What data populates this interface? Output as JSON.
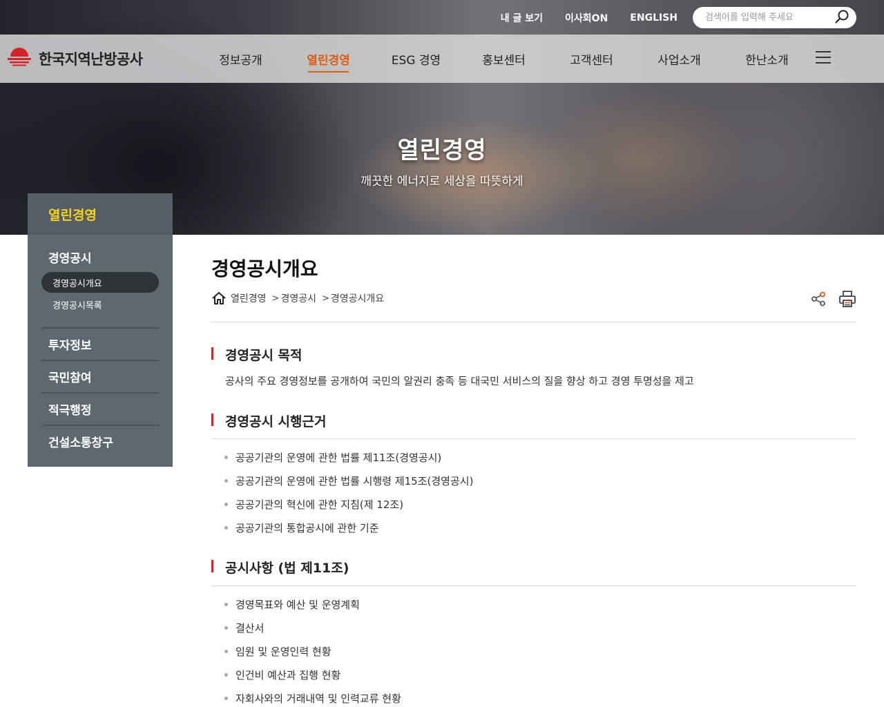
{
  "utility": {
    "my_posts": "내 글 보기",
    "board_on": "이사회ON",
    "english": "ENGLISH",
    "search_placeholder": "검색어를 입력해 주세요"
  },
  "logo": {
    "text": "한국지역난방공사",
    "brand_color": "#d3222a"
  },
  "gnb": {
    "items": [
      "정보공개",
      "열린경영",
      "ESG 경영",
      "홍보센터",
      "고객센터",
      "사업소개",
      "한난소개"
    ],
    "active_index": 1,
    "active_color": "#e05a12"
  },
  "hero": {
    "title": "열린경영",
    "subtitle": "깨끗한 에너지로 세상을 따뜻하게"
  },
  "lnb": {
    "title": "열린경영",
    "title_color": "#f7d31b",
    "group_title": "경영공시",
    "sub_items": [
      "경영공시개요",
      "경영공시목록"
    ],
    "active_sub_index": 0,
    "items": [
      "투자정보",
      "국민참여",
      "적극행정",
      "건설소통창구"
    ]
  },
  "page": {
    "title": "경영공시개요",
    "breadcrumb": [
      "열린경영",
      "경영공시",
      "경영공시개요"
    ]
  },
  "sections": [
    {
      "title": "경영공시 목적",
      "text": "공사의 주요 경영정보를 공개하여 국민의 알권리 충족 등 대국민 서비스의 질을 향상 하고 경영 투명성을 제고"
    },
    {
      "title": "경영공시 시행근거",
      "items": [
        "공공기관의 운영에 관한 법률 제11조(경영공시)",
        "공공기관의 운영에 관한 법률 시행령 제15조(경영공시)",
        "공공기관의 혁신에 관한 지침(제 12조)",
        "공공기관의 통합공시에 관한 기준"
      ]
    },
    {
      "title": "공시사항 (법 제11조)",
      "items": [
        "경영목표와 예산 및 운영계획",
        "결산서",
        "임원 및 운영인력 현황",
        "인건비 예산과 집행 현황",
        "자회사와의 거래내역 및 인력교류 현황"
      ]
    }
  ],
  "accent_color": "#d3222a"
}
